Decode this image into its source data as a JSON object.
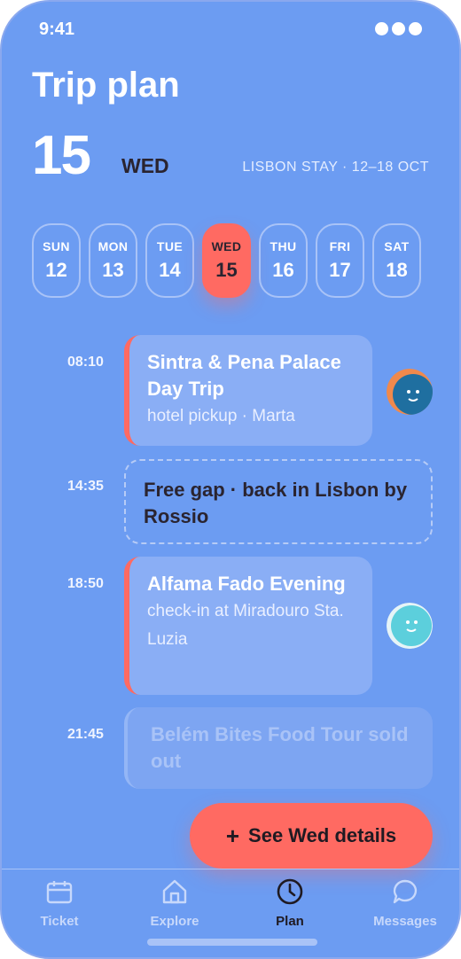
{
  "status": {
    "time": "9:41"
  },
  "header": {
    "title": "Trip plan",
    "date_number": "15",
    "weekday": "WED",
    "stay": "LISBON STAY · 12–18 OCT"
  },
  "week": [
    {
      "dn": "SUN",
      "dd": "12"
    },
    {
      "dn": "MON",
      "dd": "13"
    },
    {
      "dn": "TUE",
      "dd": "14"
    },
    {
      "dn": "WED",
      "dd": "15",
      "active": true
    },
    {
      "dn": "THU",
      "dd": "16"
    },
    {
      "dn": "FRI",
      "dd": "17"
    },
    {
      "dn": "SAT",
      "dd": "18"
    }
  ],
  "events": [
    {
      "time": "08:10",
      "title": "Sintra & Pena Palace Day Trip",
      "subtitle": "hotel pickup · Marta"
    },
    {
      "time": "14:35",
      "title": "Free gap · back in Lisbon by Rossio"
    },
    {
      "time": "18:50",
      "title": "Alfama Fado Evening",
      "subtitle": "check-in at Miradouro Sta. Luzia"
    },
    {
      "time": "21:45",
      "title": "Belém Bites Food Tour sold out"
    }
  ],
  "fab": {
    "plus": "+",
    "label": "See Wed details"
  },
  "nav": [
    {
      "label": "Ticket",
      "icon": "ticket-icon"
    },
    {
      "label": "Explore",
      "icon": "home-icon"
    },
    {
      "label": "Plan",
      "icon": "clock-icon",
      "active": true
    },
    {
      "label": "Messages",
      "icon": "chat-icon"
    }
  ],
  "colors": {
    "background": "#6c9cf2",
    "accent": "#ff6a62",
    "dark_text": "#2a2430"
  }
}
